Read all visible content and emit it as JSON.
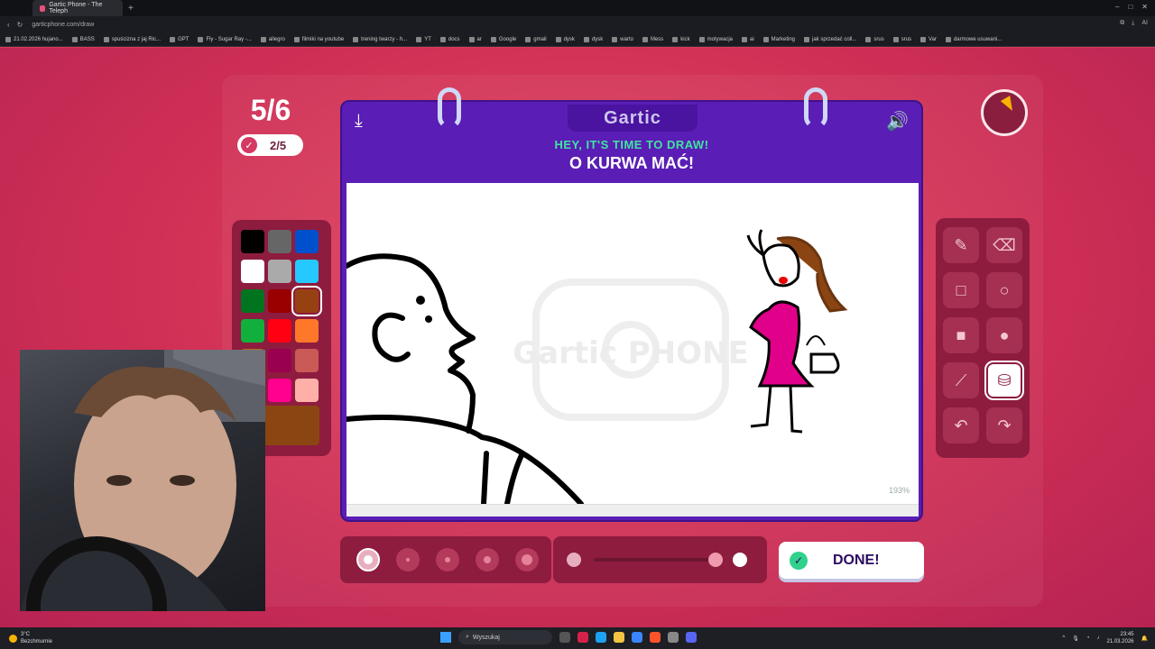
{
  "browser": {
    "tab_title": "Gartic Phone - The Teleph",
    "url": "garticphone.com/draw",
    "bookmarks": [
      "21.02.2026 hujano...",
      "BASS",
      "spuścizna z jaj Ric...",
      "GPT",
      "Fly - Sugar Ray -...",
      "allegro",
      "filmiki na youtube",
      "trening twarzy - h...",
      "YT",
      "docs",
      "ar",
      "Google",
      "gmail",
      "dysk",
      "dysk",
      "warto",
      "Mess",
      "kick",
      "motywacja",
      "ai",
      "Marketing",
      "jak sprzedać coll...",
      "srus",
      "srus",
      "Var",
      "darmowe usuwani..."
    ],
    "profile_label": "AI"
  },
  "game": {
    "round": "5/6",
    "done_count": "2/5",
    "logo": "Gartic",
    "prompt_header": "HEY, IT'S TIME TO DRAW!",
    "prompt_text": "O KURWA MAĆ!",
    "zoom": "193%",
    "done_label": "DONE!",
    "timer_remaining_fraction": 0.92,
    "watermark": "Gartic PHONE"
  },
  "palette": {
    "colors": [
      "#000000",
      "#666666",
      "#0050cd",
      "#ffffff",
      "#aaaaaa",
      "#26c9ff",
      "#017420",
      "#990000",
      "#964112",
      "#11b03c",
      "#ff0013",
      "#ff7829",
      "#b0701c",
      "#99004e",
      "#cb5a57",
      "#ffc126",
      "#ff008f",
      "#feafa8"
    ],
    "selected": "#964112",
    "current": "#8b4512"
  },
  "tools": {
    "items": [
      "pencil-icon",
      "eraser-icon",
      "square-outline-icon",
      "circle-outline-icon",
      "square-fill-icon",
      "circle-fill-icon",
      "line-icon",
      "bucket-icon",
      "undo-icon",
      "redo-icon"
    ],
    "active": "bucket-icon"
  },
  "brush": {
    "sizes": 5,
    "selected_size": 1,
    "opacity_fraction": 1.0
  },
  "taskbar": {
    "weather_temp": "3°C",
    "weather_desc": "Bezchmurnie",
    "search_placeholder": "Wyszukaj",
    "time": "23:45",
    "date": "21.03.2026"
  }
}
